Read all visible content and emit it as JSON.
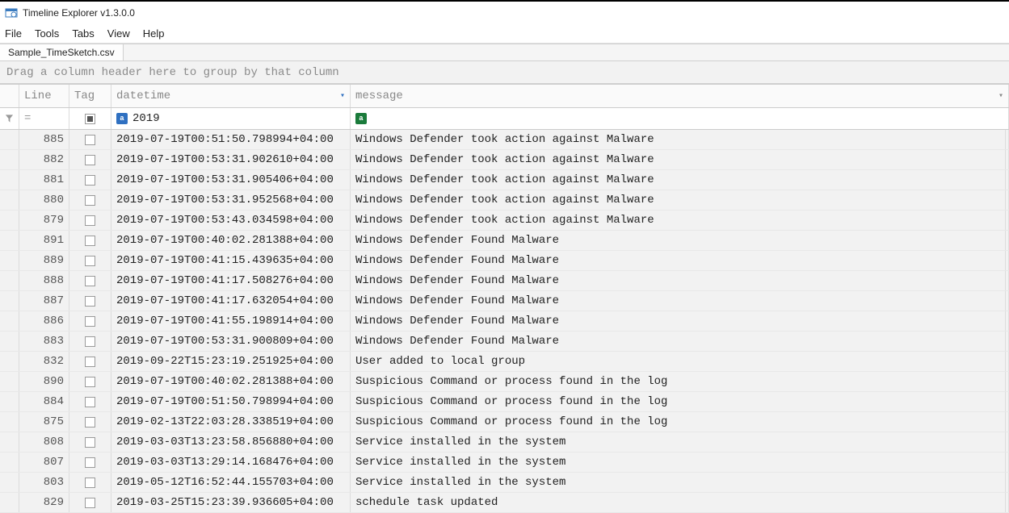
{
  "window": {
    "title": "Timeline Explorer v1.3.0.0"
  },
  "menu": [
    "File",
    "Tools",
    "Tabs",
    "View",
    "Help"
  ],
  "tabs": [
    "Sample_TimeSketch.csv"
  ],
  "group_hint": "Drag a column header here to group by that column",
  "columns": {
    "line": "Line",
    "tag": "Tag",
    "datetime": "datetime",
    "message": "message"
  },
  "filter": {
    "indicator": "=",
    "datetime_value": "2019"
  },
  "rows": [
    {
      "line": "885",
      "datetime": "2019-07-19T00:51:50.798994+04:00",
      "message": "Windows Defender took action against Malware"
    },
    {
      "line": "882",
      "datetime": "2019-07-19T00:53:31.902610+04:00",
      "message": "Windows Defender took action against Malware"
    },
    {
      "line": "881",
      "datetime": "2019-07-19T00:53:31.905406+04:00",
      "message": "Windows Defender took action against Malware"
    },
    {
      "line": "880",
      "datetime": "2019-07-19T00:53:31.952568+04:00",
      "message": "Windows Defender took action against Malware"
    },
    {
      "line": "879",
      "datetime": "2019-07-19T00:53:43.034598+04:00",
      "message": "Windows Defender took action against Malware"
    },
    {
      "line": "891",
      "datetime": "2019-07-19T00:40:02.281388+04:00",
      "message": "Windows Defender Found Malware"
    },
    {
      "line": "889",
      "datetime": "2019-07-19T00:41:15.439635+04:00",
      "message": "Windows Defender Found Malware"
    },
    {
      "line": "888",
      "datetime": "2019-07-19T00:41:17.508276+04:00",
      "message": "Windows Defender Found Malware"
    },
    {
      "line": "887",
      "datetime": "2019-07-19T00:41:17.632054+04:00",
      "message": "Windows Defender Found Malware"
    },
    {
      "line": "886",
      "datetime": "2019-07-19T00:41:55.198914+04:00",
      "message": "Windows Defender Found Malware"
    },
    {
      "line": "883",
      "datetime": "2019-07-19T00:53:31.900809+04:00",
      "message": "Windows Defender Found Malware"
    },
    {
      "line": "832",
      "datetime": "2019-09-22T15:23:19.251925+04:00",
      "message": "User added to local group"
    },
    {
      "line": "890",
      "datetime": "2019-07-19T00:40:02.281388+04:00",
      "message": "Suspicious Command or process found in the log"
    },
    {
      "line": "884",
      "datetime": "2019-07-19T00:51:50.798994+04:00",
      "message": "Suspicious Command or process found in the log"
    },
    {
      "line": "875",
      "datetime": "2019-02-13T22:03:28.338519+04:00",
      "message": "Suspicious Command or process found in the log"
    },
    {
      "line": "808",
      "datetime": "2019-03-03T13:23:58.856880+04:00",
      "message": "Service installed in the system"
    },
    {
      "line": "807",
      "datetime": "2019-03-03T13:29:14.168476+04:00",
      "message": "Service installed in the system"
    },
    {
      "line": "803",
      "datetime": "2019-05-12T16:52:44.155703+04:00",
      "message": "Service installed in the system"
    },
    {
      "line": "829",
      "datetime": "2019-03-25T15:23:39.936605+04:00",
      "message": "schedule task updated"
    }
  ]
}
